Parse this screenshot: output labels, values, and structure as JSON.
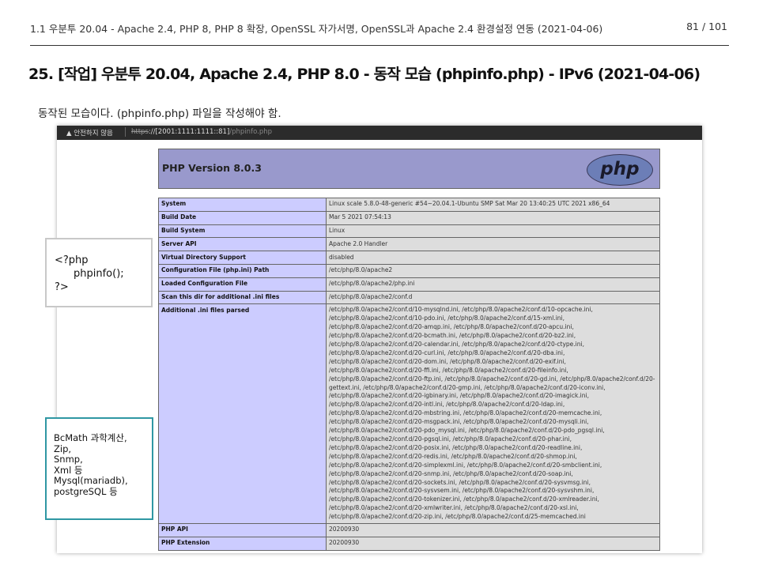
{
  "header": {
    "breadcrumb": "1.1 우분투 20.04 - Apache 2.4, PHP 8, PHP 8 확장, OpenSSL 자가서명, OpenSSL과 Apache 2.4 환경설정 연동 (2021-04-06)",
    "page_number": "81 / 101"
  },
  "title": "25. [작업] 우분투 20.04, Apache 2.4, PHP 8.0 - 동작 모습 (phpinfo.php) - IPv6 (2021-04-06)",
  "description": "동작된 모습이다. (phpinfo.php) 파일을 작성해야 함.",
  "browser": {
    "security_warning": "▲ 안전하지 않음",
    "url_scheme": "https",
    "url_host": "://[2001:1111:1111::81]",
    "url_path": "/phpinfo.php"
  },
  "php": {
    "version": "PHP Version 8.0.3",
    "logo_text": "php",
    "rows": [
      {
        "key": "System",
        "value": "Linux scale 5.8.0-48-generic #54~20.04.1-Ubuntu SMP Sat Mar 20 13:40:25 UTC 2021 x86_64"
      },
      {
        "key": "Build Date",
        "value": "Mar 5 2021 07:54:13"
      },
      {
        "key": "Build System",
        "value": "Linux"
      },
      {
        "key": "Server API",
        "value": "Apache 2.0 Handler"
      },
      {
        "key": "Virtual Directory Support",
        "value": "disabled"
      },
      {
        "key": "Configuration File (php.ini) Path",
        "value": "/etc/php/8.0/apache2"
      },
      {
        "key": "Loaded Configuration File",
        "value": "/etc/php/8.0/apache2/php.ini"
      },
      {
        "key": "Scan this dir for additional .ini files",
        "value": "/etc/php/8.0/apache2/conf.d"
      }
    ],
    "ini_key": "Additional .ini files parsed",
    "ini_lines": [
      "/etc/php/8.0/apache2/conf.d/10-mysqlnd.ini, /etc/php/8.0/apache2/conf.d/10-opcache.ini,",
      "/etc/php/8.0/apache2/conf.d/10-pdo.ini, /etc/php/8.0/apache2/conf.d/15-xml.ini,",
      "/etc/php/8.0/apache2/conf.d/20-amqp.ini, /etc/php/8.0/apache2/conf.d/20-apcu.ini,",
      "/etc/php/8.0/apache2/conf.d/20-bcmath.ini, /etc/php/8.0/apache2/conf.d/20-bz2.ini,",
      "/etc/php/8.0/apache2/conf.d/20-calendar.ini, /etc/php/8.0/apache2/conf.d/20-ctype.ini,",
      "/etc/php/8.0/apache2/conf.d/20-curl.ini, /etc/php/8.0/apache2/conf.d/20-dba.ini,",
      "/etc/php/8.0/apache2/conf.d/20-dom.ini, /etc/php/8.0/apache2/conf.d/20-exif.ini,",
      "/etc/php/8.0/apache2/conf.d/20-ffi.ini, /etc/php/8.0/apache2/conf.d/20-fileinfo.ini,",
      "/etc/php/8.0/apache2/conf.d/20-ftp.ini, /etc/php/8.0/apache2/conf.d/20-gd.ini, /etc/php/8.0/apache2/conf.d/20-",
      "gettext.ini, /etc/php/8.0/apache2/conf.d/20-gmp.ini, /etc/php/8.0/apache2/conf.d/20-iconv.ini,",
      "/etc/php/8.0/apache2/conf.d/20-igbinary.ini, /etc/php/8.0/apache2/conf.d/20-imagick.ini,",
      "/etc/php/8.0/apache2/conf.d/20-intl.ini, /etc/php/8.0/apache2/conf.d/20-ldap.ini,",
      "/etc/php/8.0/apache2/conf.d/20-mbstring.ini, /etc/php/8.0/apache2/conf.d/20-memcache.ini,",
      "/etc/php/8.0/apache2/conf.d/20-msgpack.ini, /etc/php/8.0/apache2/conf.d/20-mysqli.ini,",
      "/etc/php/8.0/apache2/conf.d/20-pdo_mysql.ini, /etc/php/8.0/apache2/conf.d/20-pdo_pgsql.ini,",
      "/etc/php/8.0/apache2/conf.d/20-pgsql.ini, /etc/php/8.0/apache2/conf.d/20-phar.ini,",
      "/etc/php/8.0/apache2/conf.d/20-posix.ini, /etc/php/8.0/apache2/conf.d/20-readline.ini,",
      "/etc/php/8.0/apache2/conf.d/20-redis.ini, /etc/php/8.0/apache2/conf.d/20-shmop.ini,",
      "/etc/php/8.0/apache2/conf.d/20-simplexml.ini, /etc/php/8.0/apache2/conf.d/20-smbclient.ini,",
      "/etc/php/8.0/apache2/conf.d/20-snmp.ini, /etc/php/8.0/apache2/conf.d/20-soap.ini,",
      "/etc/php/8.0/apache2/conf.d/20-sockets.ini, /etc/php/8.0/apache2/conf.d/20-sysvmsg.ini,",
      "/etc/php/8.0/apache2/conf.d/20-sysvsem.ini, /etc/php/8.0/apache2/conf.d/20-sysvshm.ini,",
      "/etc/php/8.0/apache2/conf.d/20-tokenizer.ini, /etc/php/8.0/apache2/conf.d/20-xmlreader.ini,",
      "/etc/php/8.0/apache2/conf.d/20-xmlwriter.ini, /etc/php/8.0/apache2/conf.d/20-xsl.ini,",
      "/etc/php/8.0/apache2/conf.d/20-zip.ini, /etc/php/8.0/apache2/conf.d/25-memcached.ini"
    ],
    "rows_after": [
      {
        "key": "PHP API",
        "value": "20200930"
      },
      {
        "key": "PHP Extension",
        "value": "20200930"
      }
    ]
  },
  "code_box": {
    "line1": "<?php",
    "line2": "phpinfo();",
    "line3": "?>"
  },
  "ext_box": {
    "lines": [
      "BcMath 과학계산,",
      "Zip,",
      "Snmp,",
      "Xml 등",
      "Mysql(mariadb),",
      "postgreSQL 등"
    ]
  },
  "colors": {
    "php_banner": "#9999cc",
    "key_cell": "#ccccff",
    "value_cell": "#dddddd",
    "callout_border": "#2f97a3"
  }
}
